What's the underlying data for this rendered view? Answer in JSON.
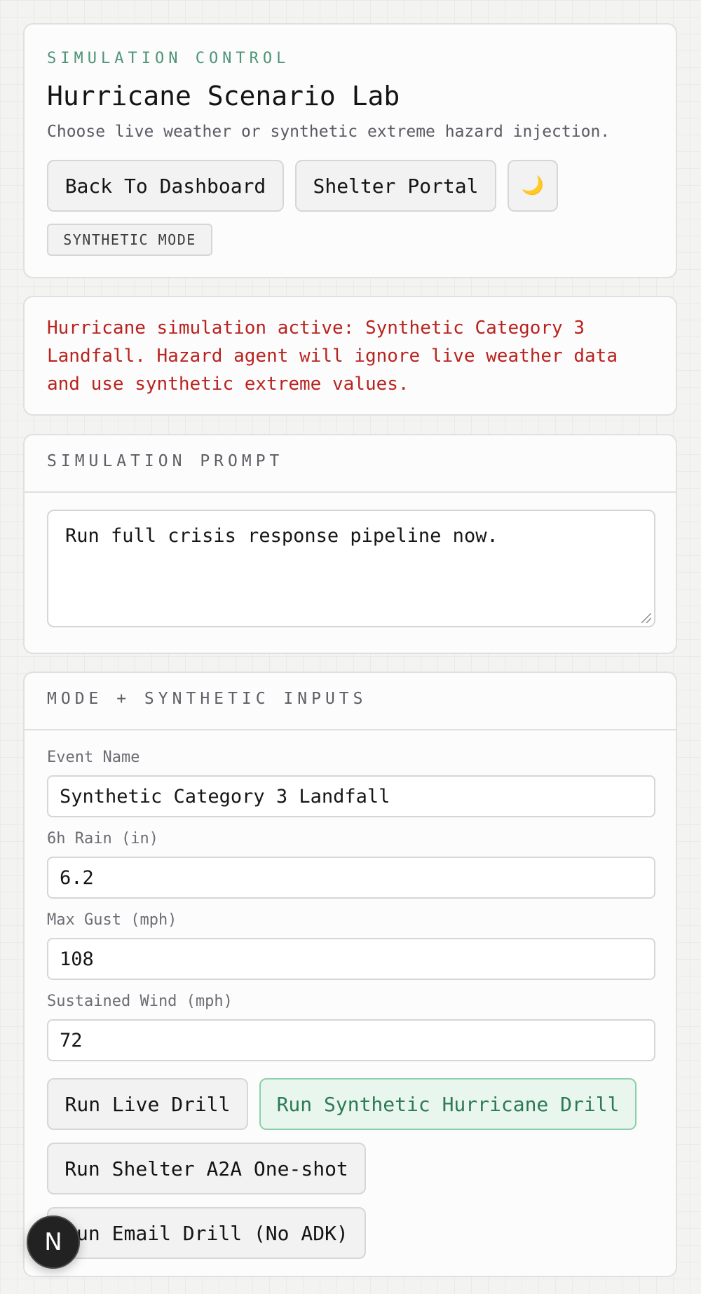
{
  "control": {
    "eyebrow": "SIMULATION CONTROL",
    "title": "Hurricane Scenario Lab",
    "subtitle": "Choose live weather or synthetic extreme hazard injection.",
    "buttons": {
      "back": "Back To Dashboard",
      "shelter": "Shelter Portal",
      "theme_icon": "🌙"
    },
    "mode_badge": "SYNTHETIC MODE"
  },
  "alert": {
    "text": "Hurricane simulation active: Synthetic Category 3 Landfall. Hazard agent will ignore live weather data and use synthetic extreme values."
  },
  "prompt": {
    "heading": "SIMULATION PROMPT",
    "value": "Run full crisis response pipeline now."
  },
  "inputs": {
    "heading": "MODE + SYNTHETIC INPUTS",
    "fields": [
      {
        "label": "Event Name",
        "value": "Synthetic Category 3 Landfall"
      },
      {
        "label": "6h Rain (in)",
        "value": "6.2"
      },
      {
        "label": "Max Gust (mph)",
        "value": "108"
      },
      {
        "label": "Sustained Wind (mph)",
        "value": "72"
      }
    ],
    "buttons": {
      "live": "Run Live Drill",
      "synthetic": "Run Synthetic Hurricane Drill",
      "a2a": "Run Shelter A2A One-shot",
      "email": "Run Email Drill (No ADK)"
    }
  },
  "badge": {
    "letter": "N"
  },
  "colors": {
    "accent_green": "#4e9478",
    "alert_red": "#b9231f",
    "synthetic_button_bg": "#e8f6ee",
    "synthetic_button_text": "#2c7a54"
  }
}
